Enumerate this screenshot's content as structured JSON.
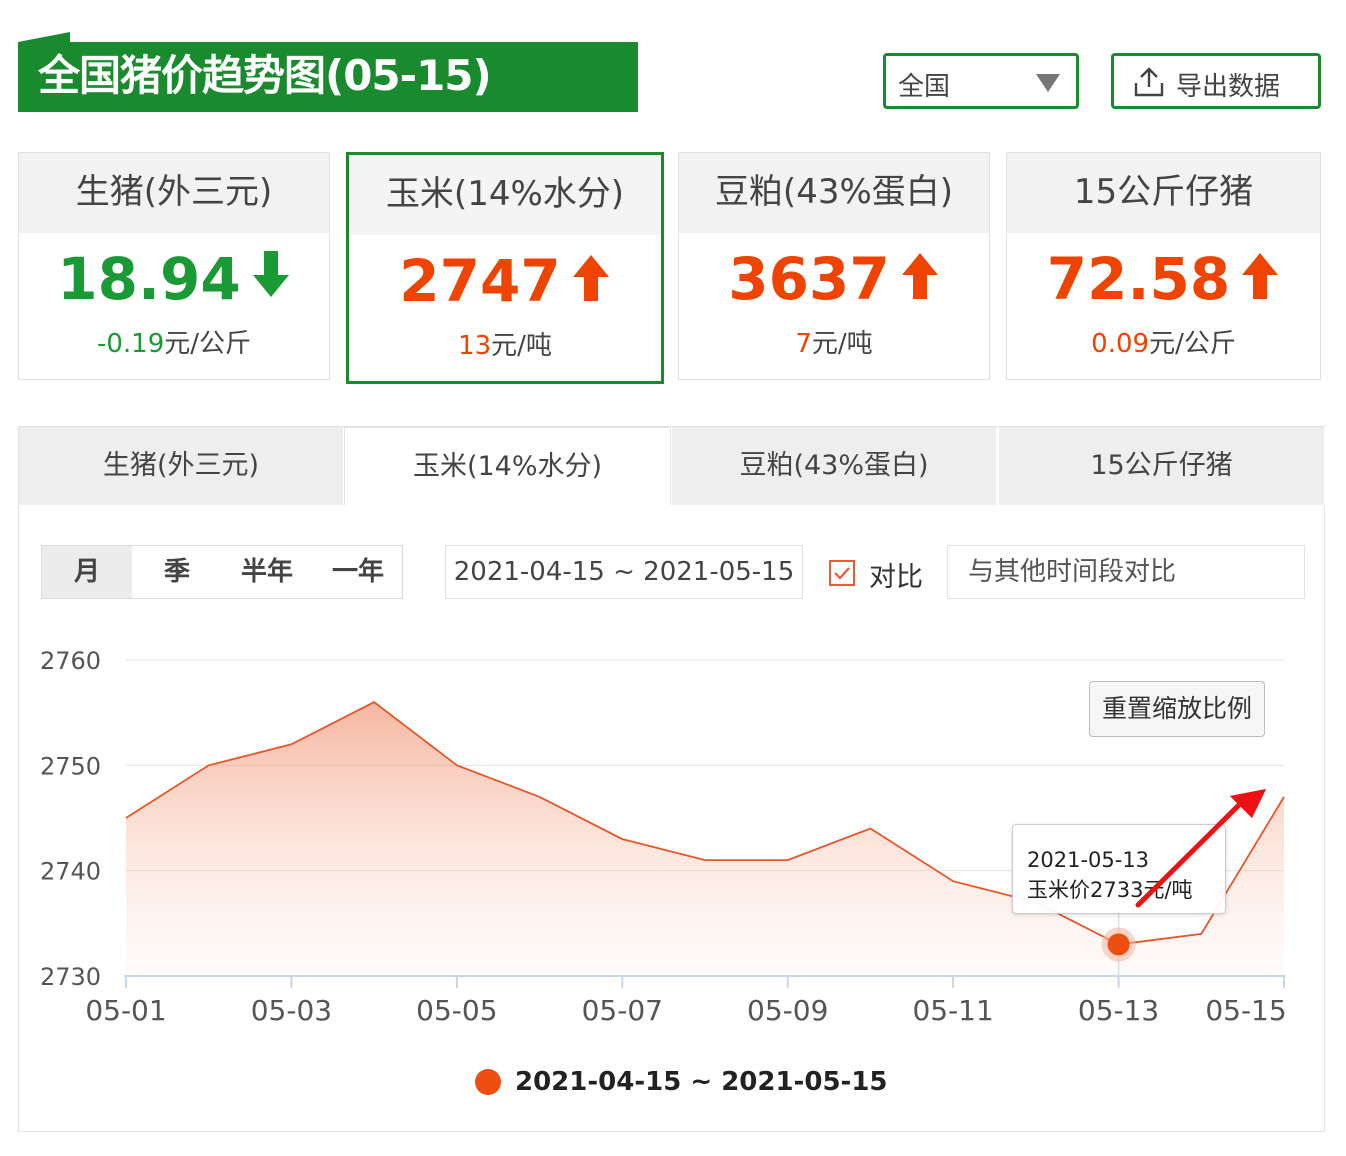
{
  "header": {
    "title": "全国猪价趋势图(05-15)",
    "region": "全国",
    "export_label": "导出数据"
  },
  "cards": [
    {
      "name": "生猪(外三元)",
      "value": "18.94",
      "direction": "down",
      "change": "-0.19",
      "unit": "元/公斤",
      "color": "#1a9a35"
    },
    {
      "name": "玉米(14%水分)",
      "value": "2747",
      "direction": "up",
      "change": "13",
      "unit": "元/吨",
      "color": "#ee4400"
    },
    {
      "name": "豆粕(43%蛋白)",
      "value": "3637",
      "direction": "up",
      "change": "7",
      "unit": "元/吨",
      "color": "#ee4400"
    },
    {
      "name": "15公斤仔猪",
      "value": "72.58",
      "direction": "up",
      "change": "0.09",
      "unit": "元/公斤",
      "color": "#ee4400"
    }
  ],
  "tabs": [
    "生猪(外三元)",
    "玉米(14%水分)",
    "豆粕(43%蛋白)",
    "15公斤仔猪"
  ],
  "controls": {
    "periods": [
      "月",
      "季",
      "半年",
      "一年"
    ],
    "selected_period": "月",
    "range": "2021-04-15 ~ 2021-05-15",
    "compare_label": "对比",
    "compare_checked": true,
    "compare_placeholder": "与其他时间段对比",
    "reset_label": "重置缩放比例"
  },
  "tooltip": {
    "date": "2021-05-13",
    "text": "玉米价2733元/吨"
  },
  "chart_data": {
    "type": "area",
    "x": [
      "05-01",
      "05-02",
      "05-03",
      "05-04",
      "05-05",
      "05-06",
      "05-07",
      "05-08",
      "05-09",
      "05-10",
      "05-11",
      "05-12",
      "05-13",
      "05-14",
      "05-15"
    ],
    "tick_labels": [
      "05-01",
      "05-03",
      "05-05",
      "05-07",
      "05-09",
      "05-11",
      "05-13",
      "05-15"
    ],
    "series": [
      {
        "name": "2021-04-15 ~ 2021-05-15",
        "values": [
          2745,
          2750,
          2752,
          2756,
          2750,
          2747,
          2743,
          2741,
          2741,
          2744,
          2739,
          2737,
          2733,
          2734,
          2747
        ],
        "color": "#ee4e10"
      }
    ],
    "ylim": [
      2730,
      2760
    ],
    "yticks": [
      2730,
      2740,
      2750,
      2760
    ],
    "highlight_index": 12,
    "grid": true,
    "legend_position": "bottom",
    "annotation": "red arrow pointing up-right"
  }
}
